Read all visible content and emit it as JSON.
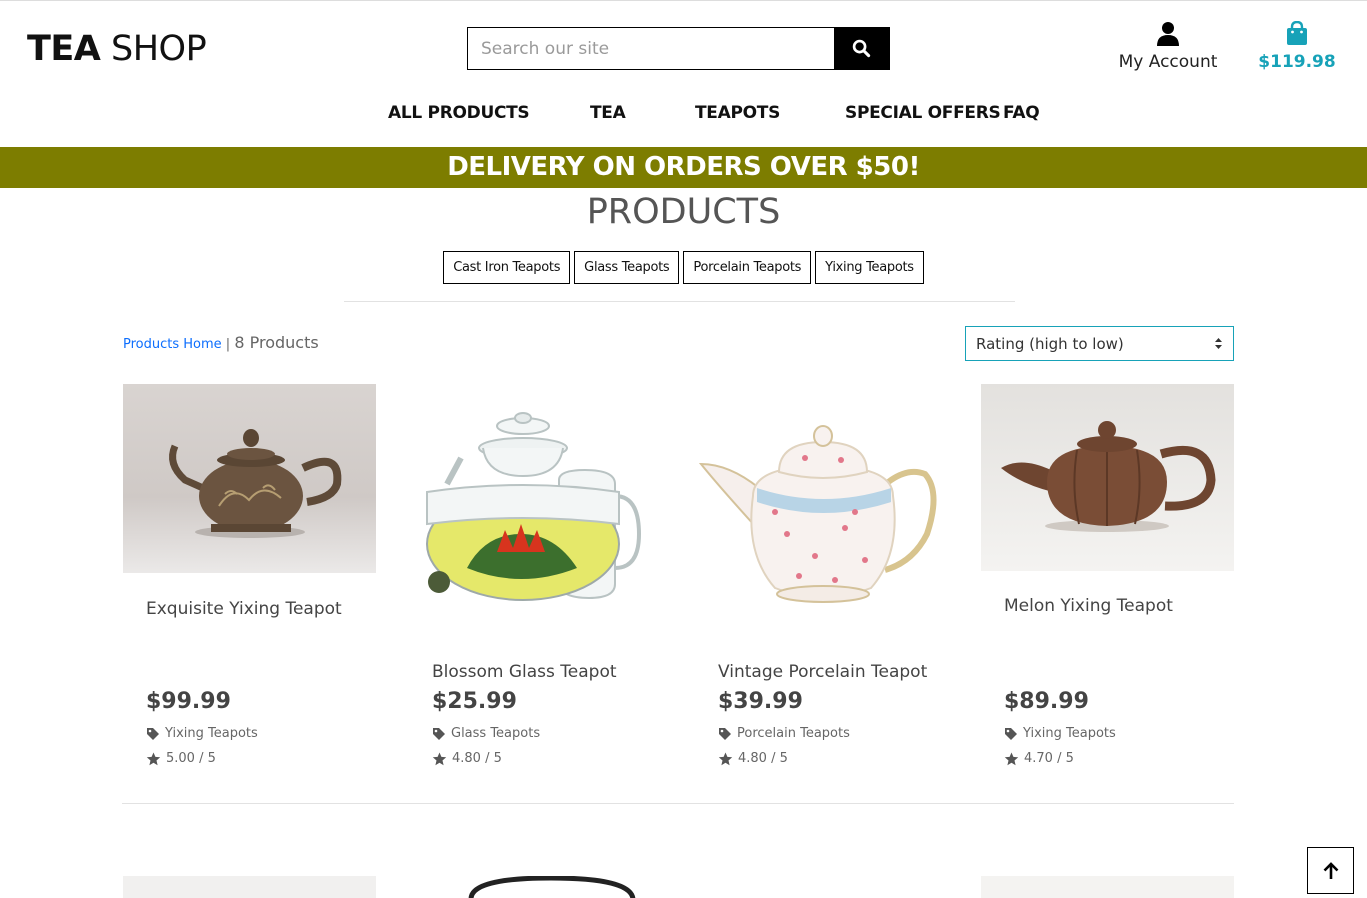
{
  "header": {
    "logo_bold": "TEA",
    "logo_light": "SHOP",
    "search_placeholder": "Search our site",
    "account_label": "My Account",
    "bag_total": "$119.98"
  },
  "nav": {
    "items": [
      "ALL PRODUCTS",
      "TEA",
      "TEAPOTS",
      "SPECIAL OFFERS",
      "FAQ"
    ]
  },
  "banner": "DELIVERY ON ORDERS OVER $50!",
  "page_title": "PRODUCTS",
  "categories": [
    "Cast Iron Teapots",
    "Glass Teapots",
    "Porcelain Teapots",
    "Yixing Teapots"
  ],
  "breadcrumb": {
    "home": "Products Home",
    "separator": "|",
    "count": "8 Products"
  },
  "sort": {
    "selected": "Rating (high to low)"
  },
  "products": [
    {
      "name": "Exquisite Yixing Teapot",
      "price": "$99.99",
      "category": "Yixing Teapots",
      "rating": "5.00 / 5"
    },
    {
      "name": "Blossom Glass Teapot",
      "price": "$25.99",
      "category": "Glass Teapots",
      "rating": "4.80 / 5"
    },
    {
      "name": "Vintage Porcelain Teapot",
      "price": "$39.99",
      "category": "Porcelain Teapots",
      "rating": "4.80 / 5"
    },
    {
      "name": "Melon Yixing Teapot",
      "price": "$89.99",
      "category": "Yixing Teapots",
      "rating": "4.70 / 5"
    }
  ],
  "colors": {
    "banner": "#7d7d00",
    "accent": "#17a2b8",
    "link": "#0d6efd"
  },
  "icons": [
    "search-icon",
    "user-icon",
    "shopping-bag-icon",
    "tag-icon",
    "star-icon",
    "sort-caret-icon",
    "arrow-up-icon"
  ]
}
